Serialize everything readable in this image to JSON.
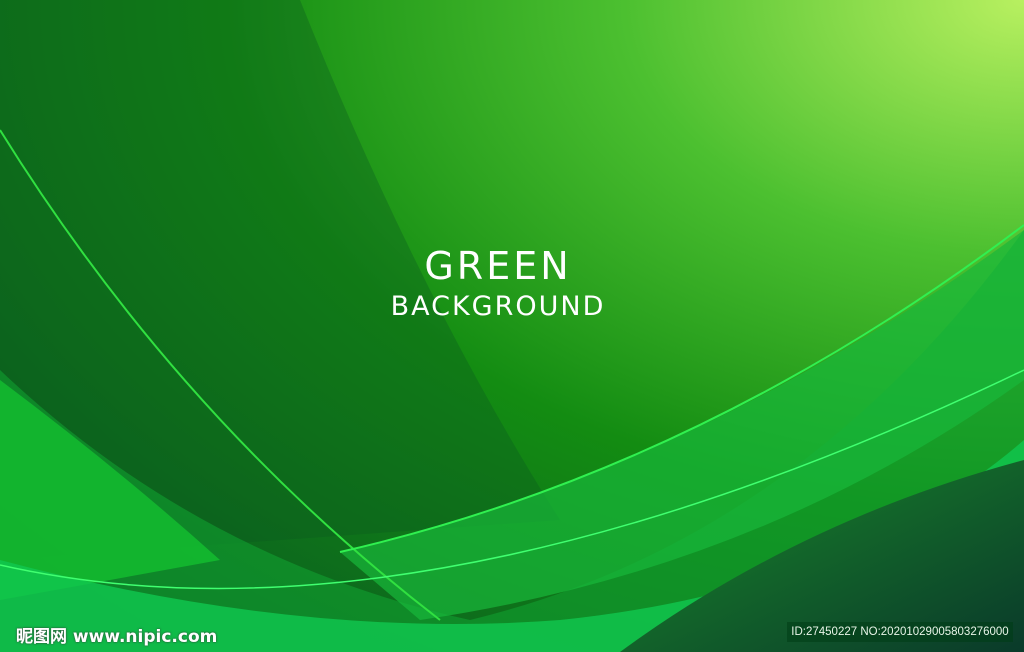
{
  "headline": "GREEN",
  "subheadline": "BACKGROUND",
  "watermark": {
    "site_name": "昵图网",
    "url": "www.nipic.com"
  },
  "image_id": "ID:27450227 NO:20201029005803276000",
  "colors": {
    "dark": "#0a5a1e",
    "mid": "#1a9a20",
    "light": "#b4f060",
    "accent": "#22e050"
  }
}
